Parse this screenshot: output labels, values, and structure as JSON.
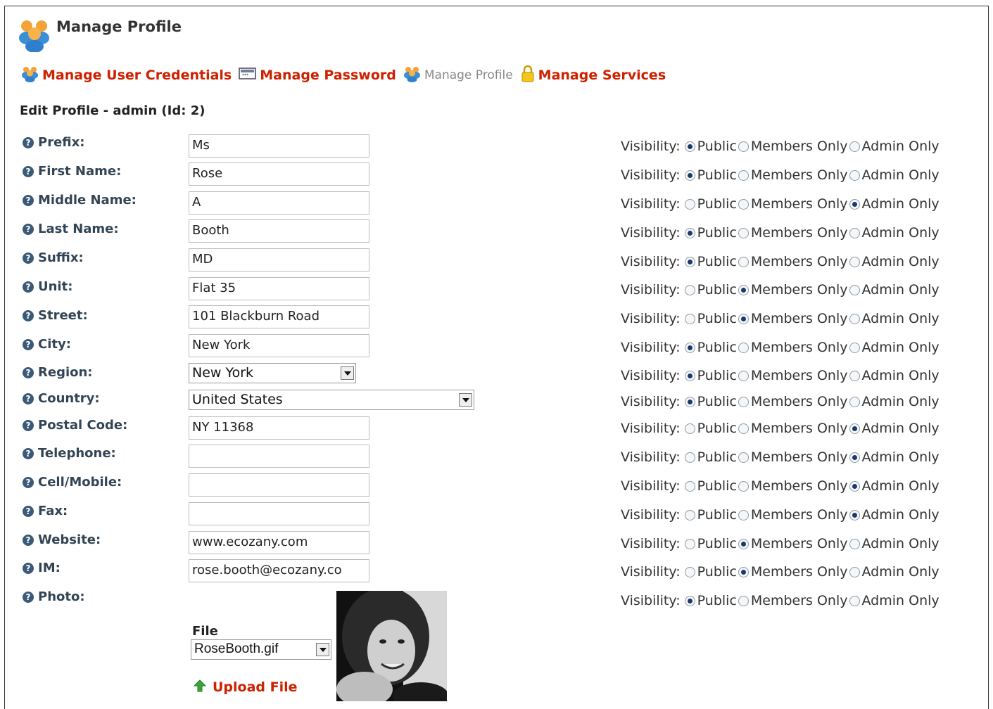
{
  "header": {
    "title": "Manage Profile"
  },
  "toolbar": {
    "items": [
      {
        "label": "Manage User Credentials"
      },
      {
        "label": "Manage Password"
      },
      {
        "label": "Manage Profile"
      },
      {
        "label": "Manage Services"
      }
    ]
  },
  "section": {
    "title": "Edit Profile - admin (Id: 2)"
  },
  "visibility": {
    "label": "Visibility:",
    "options": [
      "Public",
      "Members Only",
      "Admin Only"
    ]
  },
  "fields": [
    {
      "label": "Prefix:",
      "value": "Ms",
      "visibility": "Public"
    },
    {
      "label": "First Name:",
      "value": "Rose",
      "visibility": "Public"
    },
    {
      "label": "Middle Name:",
      "value": "A",
      "visibility": "Admin Only"
    },
    {
      "label": "Last Name:",
      "value": "Booth",
      "visibility": "Public"
    },
    {
      "label": "Suffix:",
      "value": "MD",
      "visibility": "Public"
    },
    {
      "label": "Unit:",
      "value": "Flat 35",
      "visibility": "Members Only"
    },
    {
      "label": "Street:",
      "value": "101 Blackburn Road",
      "visibility": "Members Only"
    },
    {
      "label": "City:",
      "value": "New York",
      "visibility": "Public"
    },
    {
      "label": "Region:",
      "value": "New York",
      "visibility": "Public"
    },
    {
      "label": "Country:",
      "value": "United States",
      "visibility": "Public"
    },
    {
      "label": "Postal Code:",
      "value": "NY 11368",
      "visibility": "Admin Only"
    },
    {
      "label": "Telephone:",
      "value": "",
      "visibility": "Admin Only"
    },
    {
      "label": "Cell/Mobile:",
      "value": "",
      "visibility": "Admin Only"
    },
    {
      "label": "Fax:",
      "value": "",
      "visibility": "Admin Only"
    },
    {
      "label": "Website:",
      "value": "www.ecozany.com",
      "visibility": "Members Only"
    },
    {
      "label": "IM:",
      "value": "rose.booth@ecozany.co",
      "visibility": "Members Only"
    },
    {
      "label": "Photo:",
      "value": "",
      "visibility": "Public"
    }
  ],
  "photo": {
    "file_label": "File",
    "file_value": "RoseBooth.gif",
    "upload_label": "Upload File"
  },
  "colors": {
    "link": "#cc2200",
    "label": "#334455"
  }
}
